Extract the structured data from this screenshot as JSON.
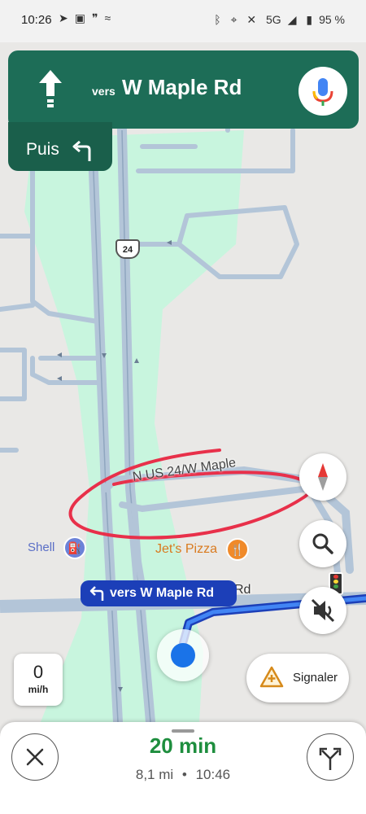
{
  "status_bar": {
    "time": "10:26",
    "left_icons": [
      "navigation-icon",
      "app-notification-icon",
      "quote-icon",
      "maps-icon"
    ],
    "right_icons": [
      "bluetooth-icon",
      "location-icon",
      "vibrate-off-icon",
      "5g-signal-icon",
      "battery-icon"
    ],
    "network": "5G",
    "battery": "95 %"
  },
  "navigation": {
    "prefix": "vers",
    "street": "W Maple Rd",
    "then_label": "Puis"
  },
  "map": {
    "highway_shield": "24",
    "road_label": "N US 24/W Maple",
    "road_label_partial": "Rd",
    "pois": [
      {
        "name": "Shell",
        "icon": "fuel-icon",
        "color": "#6c82d8"
      },
      {
        "name": "Jet's Pizza",
        "icon": "restaurant-icon",
        "color": "#f08a2a"
      }
    ],
    "route_label_prefix": "vers",
    "route_label_street": "W Maple Rd",
    "route_color": "#1c3fb8",
    "annotation_color": "#e8304a"
  },
  "speed": {
    "value": "0",
    "unit": "mi/h"
  },
  "report": {
    "label": "Signaler"
  },
  "trip": {
    "duration": "20 min",
    "distance": "8,1 mi",
    "separator": "•",
    "arrival": "10:46"
  },
  "colors": {
    "banner": "#1d6d57",
    "eta": "#1e8e3e",
    "park": "#c8f5de"
  }
}
